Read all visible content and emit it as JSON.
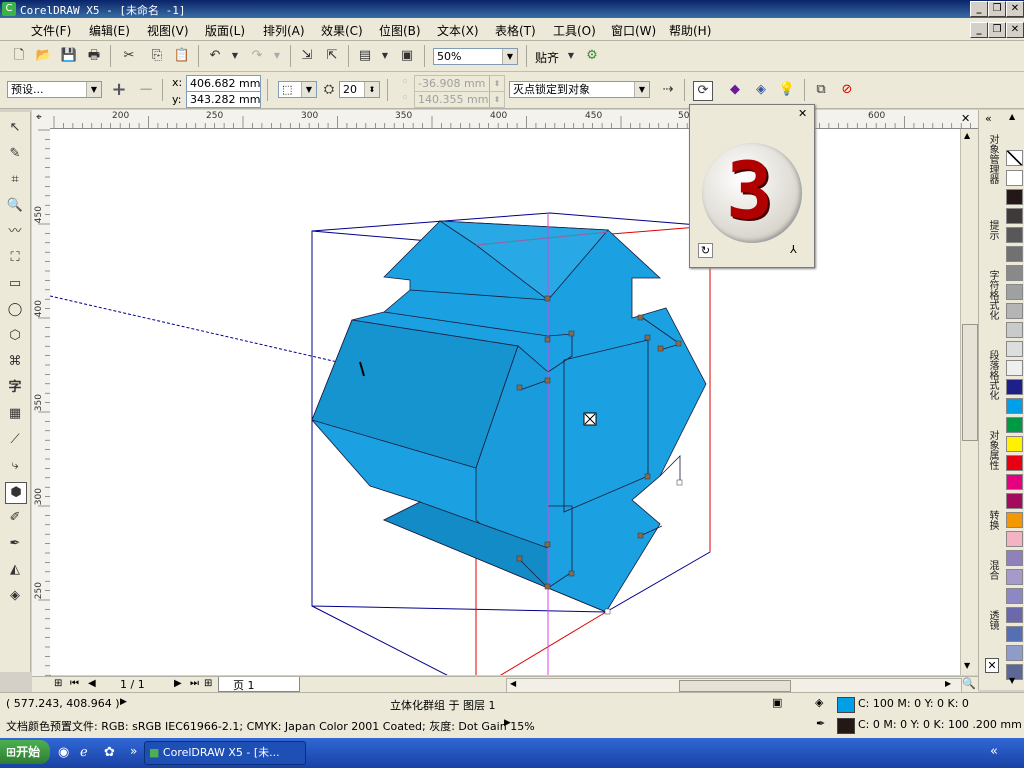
{
  "window": {
    "title": "CorelDRAW X5 - [未命名 -1]"
  },
  "menu": [
    "文件(F)",
    "编辑(E)",
    "视图(V)",
    "版面(L)",
    "排列(A)",
    "效果(C)",
    "位图(B)",
    "文本(X)",
    "表格(T)",
    "工具(O)",
    "窗口(W)",
    "帮助(H)"
  ],
  "toolbar": {
    "zoom": "50%",
    "snap_label": "贴齐"
  },
  "property_bar": {
    "preset": "预设...",
    "x_label": "x:",
    "x_value": "406.682 mm",
    "y_label": "y:",
    "y_value": "343.282 mm",
    "depth": "20",
    "vp_x": "-36.908 mm",
    "vp_y": "140.355 mm",
    "vp_lock": "灭点锁定到对象"
  },
  "ruler": {
    "h_labels": [
      "200",
      "250",
      "300",
      "350",
      "400",
      "450",
      "500",
      "600"
    ],
    "v_labels": [
      "450",
      "400",
      "350",
      "300",
      "250"
    ]
  },
  "popup": {
    "digit": "3"
  },
  "dockers": [
    "对象管理器",
    "提示",
    "字符格式化",
    "段落格式化",
    "对象属性",
    "转换",
    "混合",
    "透镜"
  ],
  "palette": {
    "colors": [
      "#ffffff",
      "#231815",
      "#3d3a39",
      "#595757",
      "#727171",
      "#898989",
      "#9fa0a0",
      "#b5b5b6",
      "#c9caca",
      "#dcdddd",
      "#efefef",
      "#1d2088",
      "#00a0e9",
      "#009944",
      "#fff100",
      "#e60012",
      "#e4007f",
      "#a40b5d",
      "#f39800",
      "#f4b3c2",
      "#8f82bc",
      "#a59aca",
      "#8c88c3",
      "#6c69ab",
      "#556fb5",
      "#8f9bc8",
      "#5d6795"
    ]
  },
  "page_nav": {
    "counter": "1 / 1",
    "tab": "页 1"
  },
  "status": {
    "coords": "( 577.243, 408.964 )",
    "object_info": "立体化群组 于 图层 1",
    "fill": "C: 100 M: 0 Y: 0 K: 0",
    "outline": "C: 0 M: 0 Y: 0 K: 100  .200 mm",
    "doc_profile": "文档颜色预置文件: RGB: sRGB IEC61966-2.1; CMYK: Japan Color 2001 Coated; 灰度: Dot Gain 15%",
    "fill_color": "#00a0e9",
    "outline_color": "#231815"
  },
  "taskbar": {
    "start": "开始",
    "task": "CorelDRAW X5 - [未..."
  },
  "colors": {
    "shape_fill": "#1ba1e2",
    "title_bar": "#0a246a"
  }
}
